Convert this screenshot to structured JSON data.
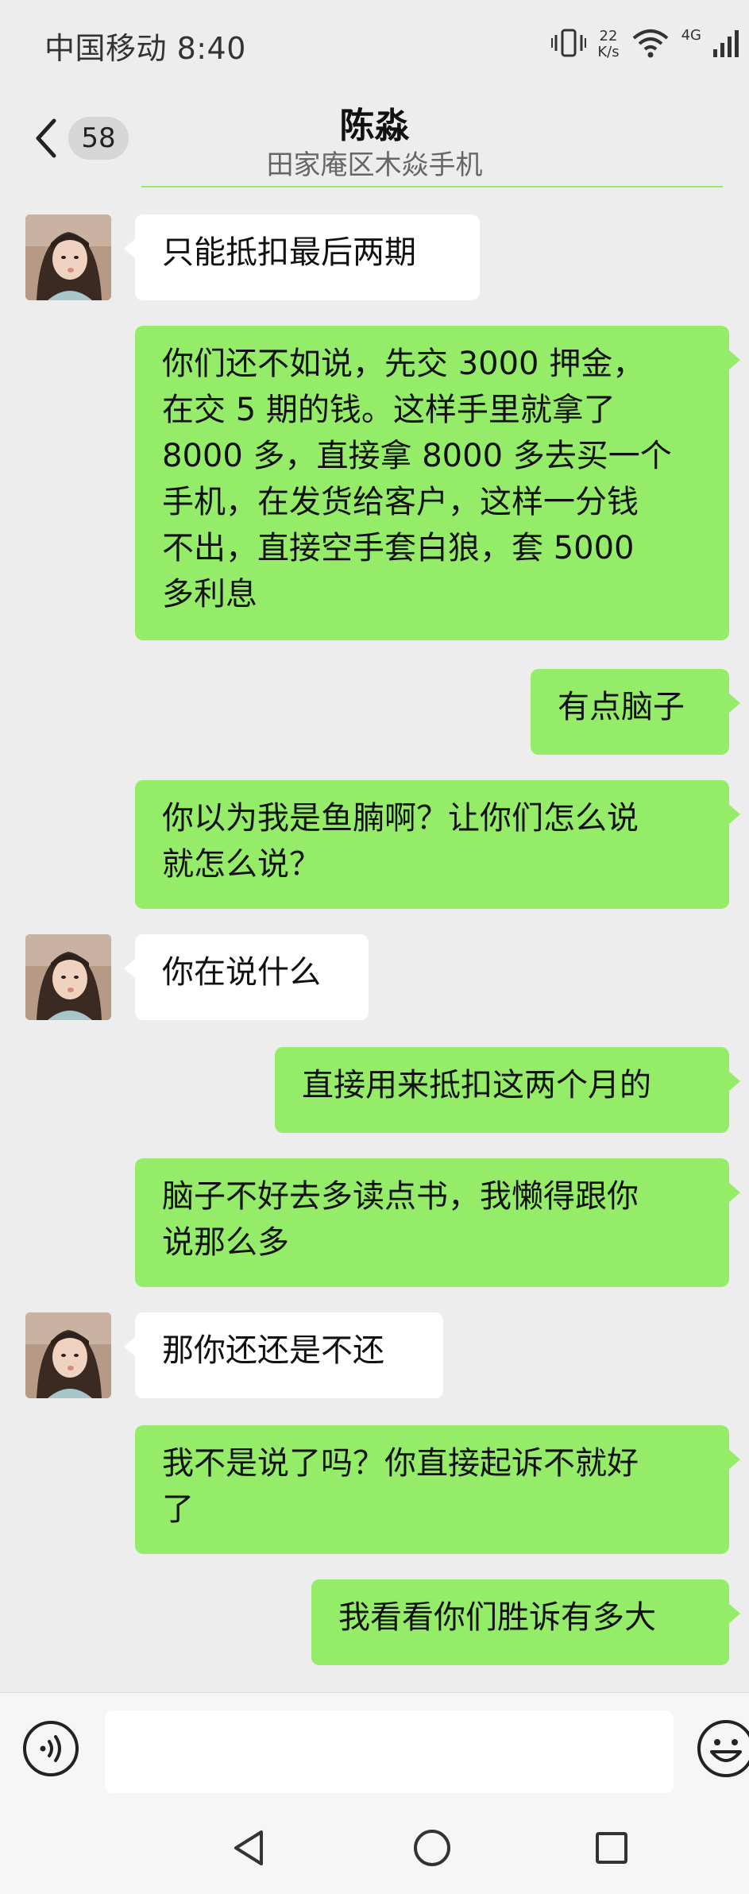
{
  "status_bar": {
    "carrier_time": "中国移动 8:40",
    "speed_value": "22",
    "speed_unit": "K/s",
    "network": "4G"
  },
  "header": {
    "unread_count": "58",
    "contact_name": "陈淼",
    "contact_subtitle": "田家庵区木焱手机"
  },
  "messages": [
    {
      "sender": "contact",
      "text": "只能抵扣最后两期"
    },
    {
      "sender": "me",
      "text": "你们还不如说，先交 3000 押金，\n在交 5 期的钱。这样手里就拿了\n8000 多，直接拿 8000 多去买一个\n手机，在发货给客户，这样一分钱\n不出，直接空手套白狼，套 5000\n多利息"
    },
    {
      "sender": "me",
      "text": "有点脑子"
    },
    {
      "sender": "me",
      "text": "你以为我是鱼腩啊？让你们怎么说\n就怎么说？"
    },
    {
      "sender": "contact",
      "text": "你在说什么"
    },
    {
      "sender": "me",
      "text": "直接用来抵扣这两个月的"
    },
    {
      "sender": "me",
      "text": "脑子不好去多读点书，我懒得跟你\n说那么多"
    },
    {
      "sender": "contact",
      "text": "那你还还是不还"
    },
    {
      "sender": "me",
      "text": "我不是说了吗？你直接起诉不就好\n了"
    },
    {
      "sender": "me",
      "text": "我看看你们胜诉有多大"
    }
  ],
  "input": {
    "value": "",
    "placeholder": ""
  },
  "colors": {
    "sent_bubble": "#95ec69",
    "received_bubble": "#ffffff",
    "background": "#ededed"
  }
}
